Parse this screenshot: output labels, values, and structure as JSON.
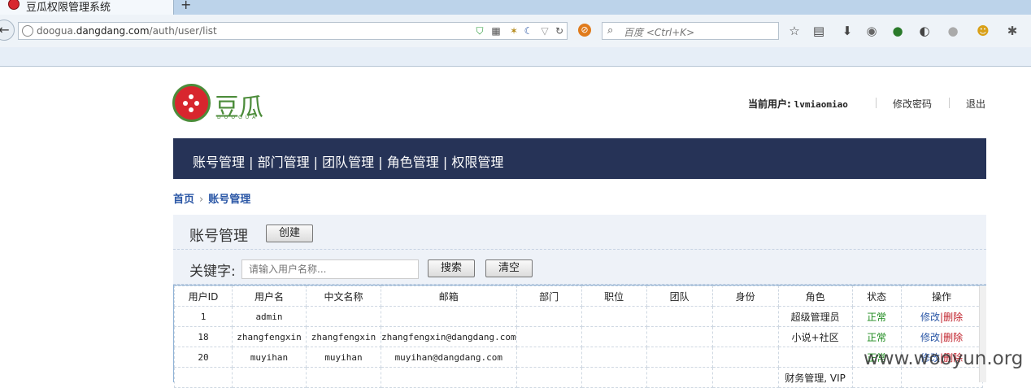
{
  "browser": {
    "tab_title": "豆瓜权限管理系统",
    "new_tab": "+",
    "url_host_prefix": "doogua.",
    "url_host": "dangdang.com",
    "url_path": "/auth/user/list",
    "search_placeholder": "百度 <Ctrl+K>"
  },
  "header": {
    "logo_text": "豆瓜",
    "logo_sub": "DOOGUA",
    "current_user_label": "当前用户:",
    "current_user": "lvmiaomiao",
    "change_password": "修改密码",
    "logout": "退出"
  },
  "nav": {
    "items": [
      "账号管理",
      "部门管理",
      "团队管理",
      "角色管理",
      "权限管理"
    ],
    "separator": " | "
  },
  "breadcrumb": {
    "home": "首页",
    "arrow": "›",
    "current": "账号管理"
  },
  "panel": {
    "title": "账号管理",
    "create_button": "创建",
    "keyword_label": "关键字:",
    "keyword_placeholder": "请输入用户名称...",
    "search_button": "搜索",
    "clear_button": "清空"
  },
  "table": {
    "columns": [
      "用户ID",
      "用户名",
      "中文名称",
      "邮箱",
      "部门",
      "职位",
      "团队",
      "身份",
      "角色",
      "状态",
      "操作"
    ],
    "rows": [
      {
        "id": "1",
        "username": "admin",
        "cn_name": "",
        "email": "",
        "dept": "",
        "position": "",
        "team": "",
        "identity": "",
        "role": "超级管理员",
        "status": "正常",
        "edit": "修改",
        "del": "删除"
      },
      {
        "id": "18",
        "username": "zhangfengxin",
        "cn_name": "zhangfengxin",
        "email": "zhangfengxin@dangdang.com",
        "dept": "",
        "position": "",
        "team": "",
        "identity": "",
        "role": "小说+社区",
        "status": "正常",
        "edit": "修改",
        "del": "删除"
      },
      {
        "id": "20",
        "username": "muyihan",
        "cn_name": "muyihan",
        "email": "muyihan@dangdang.com",
        "dept": "",
        "position": "",
        "team": "",
        "identity": "",
        "role": "",
        "status": "正常",
        "edit": "修改",
        "del": "删除"
      },
      {
        "id": "",
        "username": "",
        "cn_name": "",
        "email": "",
        "dept": "",
        "position": "",
        "team": "",
        "identity": "",
        "role": "财务管理, VIP",
        "status": "",
        "edit": "",
        "del": ""
      }
    ]
  },
  "watermark": "www.wooyun.org",
  "colors": {
    "nav_bg": "#263357",
    "brand_green": "#4c8c3a",
    "brand_red": "#d8262e",
    "link_blue": "#2b57a6"
  }
}
